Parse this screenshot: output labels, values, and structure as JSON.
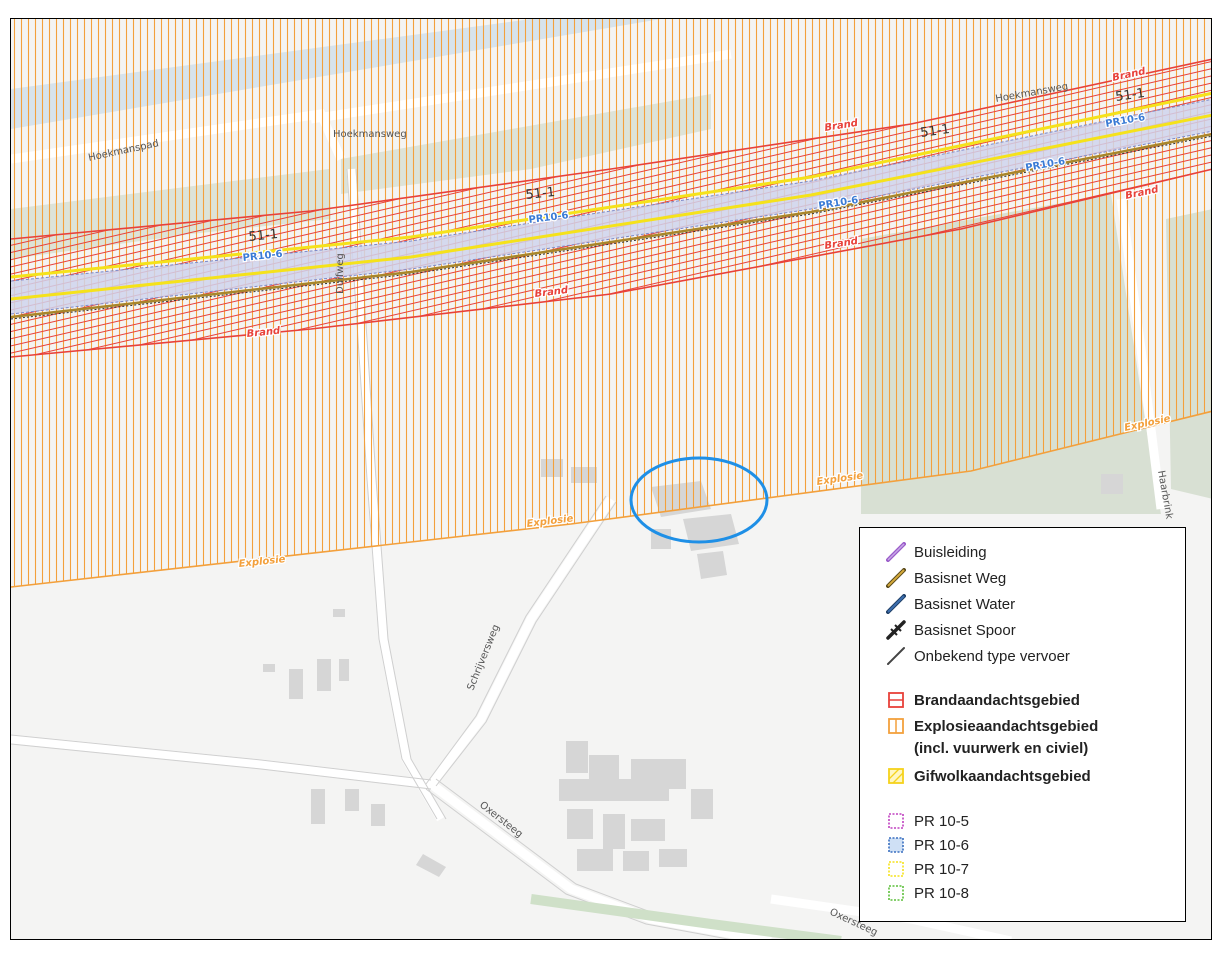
{
  "streets": {
    "hoekmanspad": "Hoekmanspad",
    "hoekmansweg_1": "Hoekmansweg",
    "hoekmansweg_2": "Hoekmansweg",
    "duifweg": "Duifweg",
    "schrijversweg": "Schrijversweg",
    "oxersteeg_1": "Oxersteeg",
    "oxersteeg_2": "Oxersteeg",
    "haarbrink": "Haarbrink"
  },
  "route_labels": {
    "route_id": "51-1",
    "pr": "PR10-6",
    "brand": "Brand",
    "explosie": "Explosie"
  },
  "colors": {
    "brand": "#e8413a",
    "explosie": "#f3a03c",
    "pr10_6": "#3a7bd5",
    "route_yellow": "#f5e21b",
    "marker_circle": "#1e8fe6"
  },
  "legend": {
    "items": [
      {
        "icon": "pipeline-line-icon",
        "label": "Buisleiding"
      },
      {
        "icon": "road-line-icon",
        "label": "Basisnet Weg"
      },
      {
        "icon": "water-line-icon",
        "label": "Basisnet Water"
      },
      {
        "icon": "rail-line-icon",
        "label": "Basisnet Spoor"
      },
      {
        "icon": "unknown-transport-line-icon",
        "label": "Onbekend type vervoer"
      }
    ],
    "areas": [
      {
        "icon": "brand-area-icon",
        "label": "Brandaandachtsgebied"
      },
      {
        "icon": "explosion-area-icon",
        "label": "Explosieaandachtsgebied",
        "label2": "(incl. vuurwerk en civiel)"
      },
      {
        "icon": "toxic-cloud-area-icon",
        "label": "Gifwolkaandachtsgebied"
      }
    ],
    "pr": [
      {
        "icon": "pr-10-5-icon",
        "label": "PR 10-5"
      },
      {
        "icon": "pr-10-6-icon",
        "label": "PR 10-6"
      },
      {
        "icon": "pr-10-7-icon",
        "label": "PR 10-7"
      },
      {
        "icon": "pr-10-8-icon",
        "label": "PR 10-8"
      }
    ]
  }
}
